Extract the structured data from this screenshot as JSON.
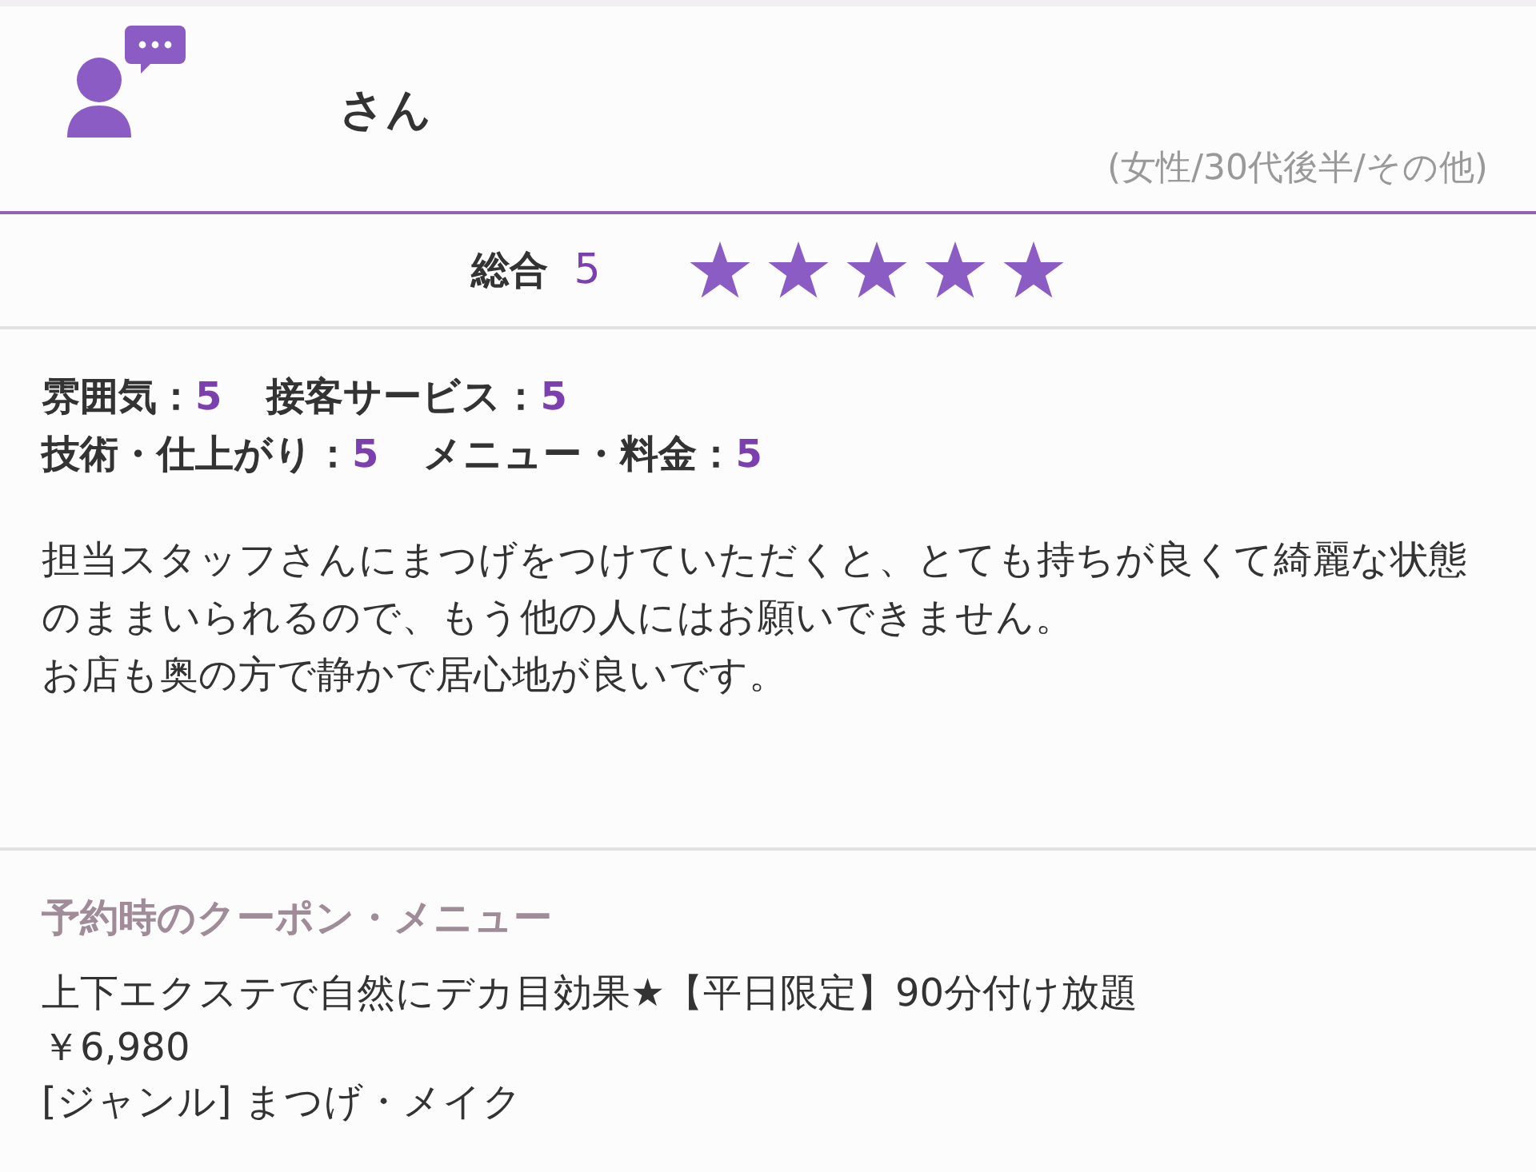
{
  "reviewer": {
    "name": "さん",
    "profile": "(女性/30代後半/その他)"
  },
  "overall": {
    "label": "総合",
    "score": "5",
    "stars": 5
  },
  "ratings": [
    [
      {
        "label": "雰囲気：",
        "score": "5"
      },
      {
        "label": "接客サービス：",
        "score": "5"
      }
    ],
    [
      {
        "label": "技術・仕上がり：",
        "score": "5"
      },
      {
        "label": "メニュー・料金：",
        "score": "5"
      }
    ]
  ],
  "comment": [
    "担当スタッフさんにまつげをつけていただくと、とても持ちが良くて綺麗な状態のままいられるので、もう他の人にはお願いできません。",
    "お店も奥の方で静かで居心地が良いです。"
  ],
  "coupon": {
    "heading": "予約時のクーポン・メニュー",
    "lines": [
      "上下エクステで自然にデカ目効果★【平日限定】90分付け放題",
      "￥6,980",
      "[ジャンル] まつげ・メイク"
    ]
  }
}
